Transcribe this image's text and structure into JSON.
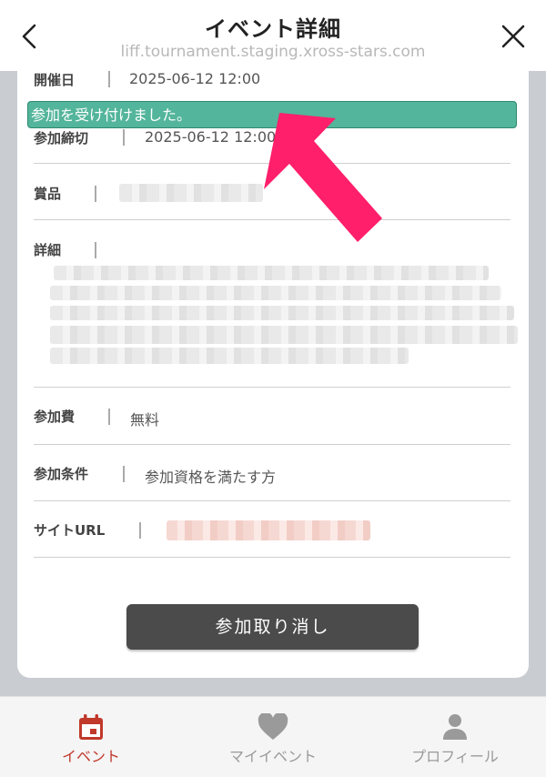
{
  "header": {
    "title": "イベント詳細",
    "url": "liff.tournament.staging.xross-stars.com",
    "back_icon": "chevron-left-icon",
    "close_icon": "close-icon"
  },
  "toast": {
    "message": "参加を受け付けました。",
    "color": "#53b59b"
  },
  "details": {
    "start": {
      "label": "開催日",
      "value": "2025-06-12 12:00"
    },
    "deadline": {
      "label": "参加締切",
      "value": "2025-06-12 12:00"
    },
    "prize": {
      "label": "賞品"
    },
    "detail": {
      "label": "詳細"
    },
    "fee": {
      "label": "参加費",
      "value": "無料"
    },
    "requirement": {
      "label": "参加条件",
      "value": "参加資格を満たす方"
    },
    "site": {
      "label": "サイトURL"
    }
  },
  "actions": {
    "cancel_label": "参加取り消し"
  },
  "bottom_nav": {
    "items": [
      {
        "label": "イベント",
        "icon": "calendar-icon",
        "active": true
      },
      {
        "label": "マイイベント",
        "icon": "heart-icon",
        "active": false
      },
      {
        "label": "プロフィール",
        "icon": "person-icon",
        "active": false
      }
    ],
    "active_color": "#c0392b"
  }
}
